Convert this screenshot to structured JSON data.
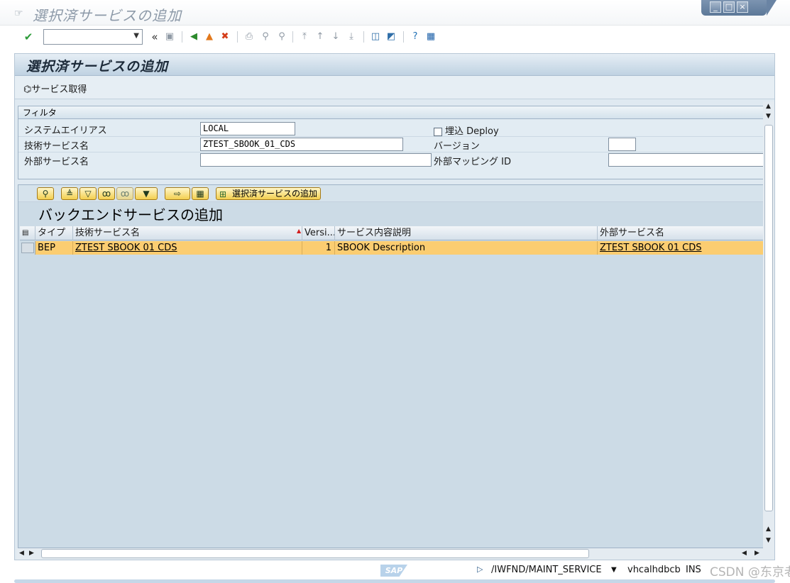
{
  "window": {
    "title": "選択済サービスの追加",
    "controls": [
      "_",
      "□",
      "×"
    ]
  },
  "toolbar": {
    "command_value": "",
    "history_back": "«"
  },
  "screen": {
    "title": "選択済サービスの追加",
    "fetch_services": "サービス取得"
  },
  "filter": {
    "caption": "フィルタ",
    "system_alias_label": "システムエイリアス",
    "system_alias_value": "LOCAL",
    "tech_service_label": "技術サービス名",
    "tech_service_value": "ZTEST_SBOOK_01_CDS",
    "external_service_label": "外部サービス名",
    "external_service_value": "",
    "embedded_deploy_label": "埋込 Deploy",
    "version_label": "バージョン",
    "version_value": "",
    "external_mapping_label": "外部マッピング ID",
    "external_mapping_value": ""
  },
  "alv": {
    "add_selected_button": "選択済サービスの追加",
    "title": "バックエンドサービスの追加",
    "columns": {
      "type": "タイプ",
      "tech_name": "技術サービス名",
      "version": "Versi...",
      "description": "サービス内容説明",
      "external_name": "外部サービス名"
    },
    "rows": [
      {
        "type": "BEP",
        "tech_name": "ZTEST SBOOK 01 CDS",
        "version": "1",
        "description": "SBOOK Description",
        "external_name": "ZTEST SBOOK 01 CDS"
      }
    ]
  },
  "status": {
    "transaction": "/IWFND/MAINT_SERVICE",
    "server": "vhcalhdbcb",
    "mode": "INS",
    "watermark": "CSDN @东京老树根"
  },
  "colors": {
    "selected_row": "#fbcd71",
    "screen_bg": "#dfe9f1",
    "button_yellow": "#f3cf4f"
  }
}
